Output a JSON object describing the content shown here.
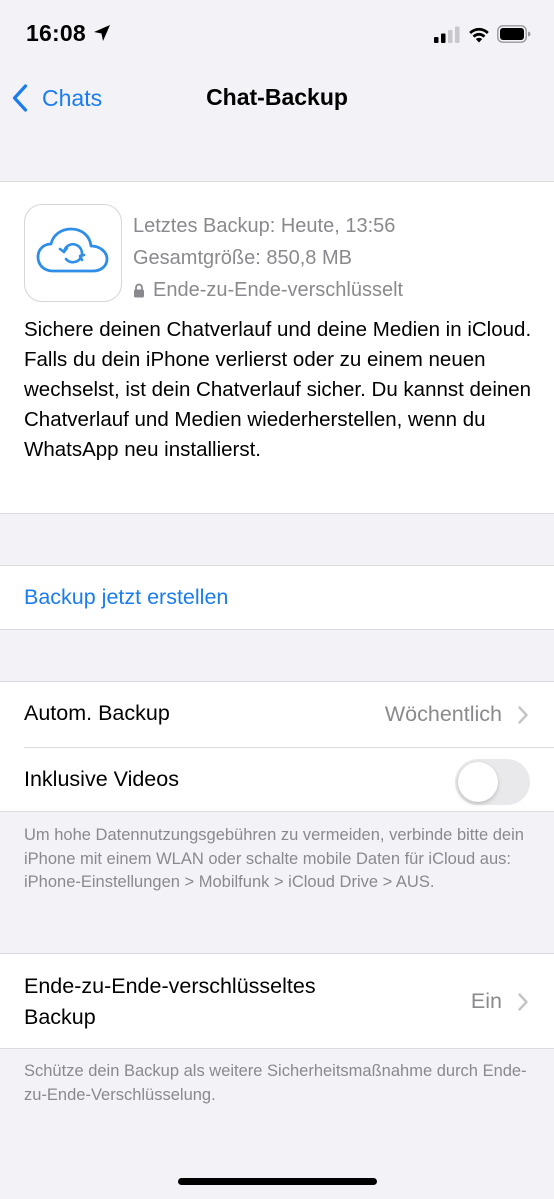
{
  "status_bar": {
    "time": "16:08",
    "icons": [
      "location-arrow-icon",
      "signal-icon",
      "wifi-icon",
      "battery-icon"
    ]
  },
  "nav": {
    "back_label": "Chats",
    "title": "Chat-Backup",
    "accent_color": "#1a7cf0"
  },
  "backup_info": {
    "icon": "icloud-sync-icon",
    "last_backup": "Letztes Backup: Heute, 13:56",
    "total_size": "Gesamtgröße: 850,8 MB",
    "encryption": "Ende-zu-Ende-verschlüsselt",
    "description": "Sichere deinen Chatverlauf und deine Medien in iCloud. Falls du dein iPhone verlierst oder zu einem neuen wechselst, ist dein Chatverlauf sicher. Du kannst deinen Chatverlauf und Medien wiederherstellen, wenn du WhatsApp neu installierst."
  },
  "actions": {
    "backup_now": "Backup jetzt erstellen"
  },
  "settings": {
    "auto_backup_label": "Autom. Backup",
    "auto_backup_value": "Wöchentlich",
    "include_videos_label": "Inklusive Videos",
    "include_videos_enabled": false,
    "data_note": "Um hohe Datennutzungsgebühren zu vermeiden, verbinde bitte dein iPhone mit einem WLAN oder schalte mobile Daten für iCloud aus: iPhone-Einstellungen > Mobilfunk > iCloud Drive > AUS."
  },
  "e2e": {
    "label": "Ende-zu-Ende-verschlüsseltes Backup",
    "value": "Ein",
    "note": "Schütze dein Backup als weitere Sicherheitsmaßnahme durch Ende-zu-Ende-Verschlüsselung."
  }
}
